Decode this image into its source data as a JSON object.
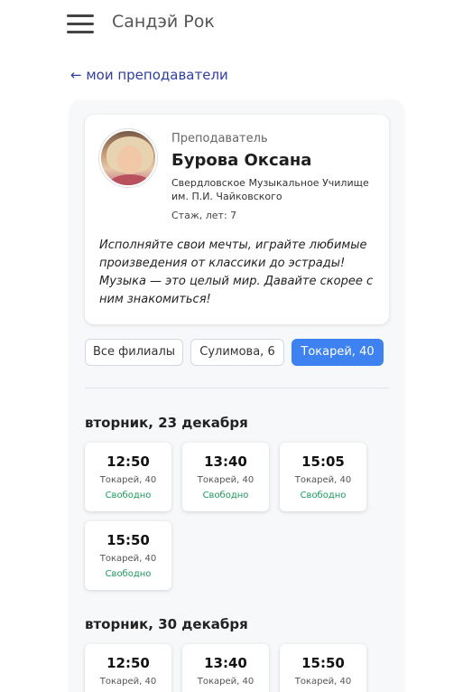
{
  "header": {
    "menu_icon": "hamburger-menu-icon",
    "title": "Сандэй Рок"
  },
  "back_link": "← мои преподаватели",
  "teacher": {
    "role": "Преподаватель",
    "name": "Бурова Оксана",
    "school": "Свердловское Музыкальное Училище им. П.И. Чайковского",
    "experience": "Стаж, лет: 7",
    "quote": "Исполняйте свои мечты, играйте любимые произведения от классики до эстрады! Музыка — это целый мир. Давайте скорее с ним знакомиться!"
  },
  "filters": [
    {
      "label": "Все филиалы",
      "active": false
    },
    {
      "label": "Сулимова, 6",
      "active": false
    },
    {
      "label": "Токарей, 40",
      "active": true
    }
  ],
  "colors": {
    "accent": "#3d82f0",
    "free_status": "#1d9a5b",
    "back_link": "#2f3fa0"
  },
  "days": [
    {
      "heading": "вторник, 23 декабря",
      "slots": [
        {
          "time": "12:50",
          "place": "Токарей, 40",
          "status": "Свободно"
        },
        {
          "time": "13:40",
          "place": "Токарей, 40",
          "status": "Свободно"
        },
        {
          "time": "15:05",
          "place": "Токарей, 40",
          "status": "Свободно"
        },
        {
          "time": "15:50",
          "place": "Токарей, 40",
          "status": "Свободно"
        }
      ]
    },
    {
      "heading": "вторник, 30 декабря",
      "slots": [
        {
          "time": "12:50",
          "place": "Токарей, 40",
          "status": ""
        },
        {
          "time": "13:40",
          "place": "Токарей, 40",
          "status": ""
        },
        {
          "time": "15:50",
          "place": "Токарей, 40",
          "status": ""
        }
      ]
    }
  ]
}
